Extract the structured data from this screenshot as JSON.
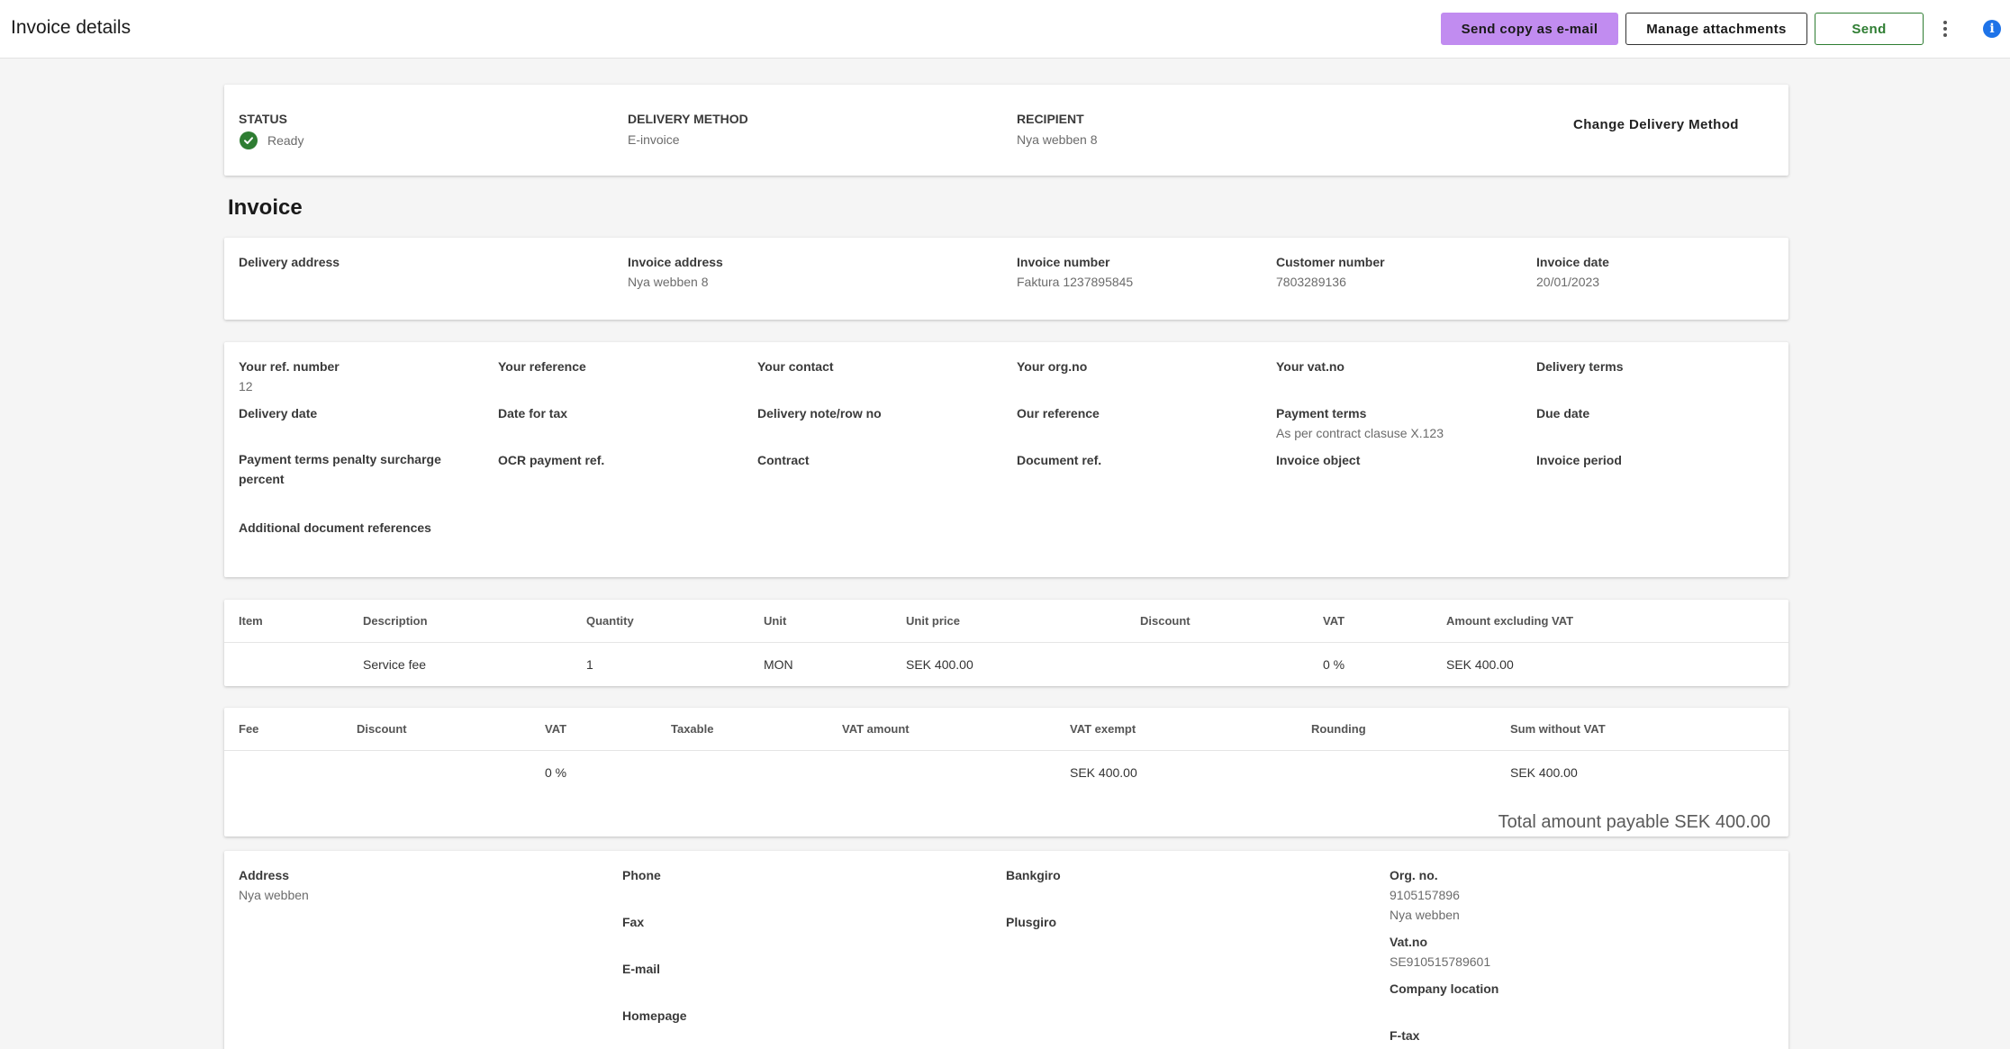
{
  "header": {
    "title": "Invoice details",
    "send_email_label": "Send copy as e-mail",
    "manage_attachments_label": "Manage attachments",
    "send_label": "Send",
    "more_icon": "kebab-menu-icon",
    "info_icon": "info-icon"
  },
  "status_card": {
    "status_label": "STATUS",
    "status_value": "Ready",
    "delivery_method_label": "DELIVERY METHOD",
    "delivery_method_value": "E-invoice",
    "recipient_label": "RECIPIENT",
    "recipient_value": "Nya webben 8",
    "change_label": "Change Delivery Method",
    "status_color": "#2e7d32"
  },
  "invoice": {
    "section_title": "Invoice",
    "delivery_address_label": "Delivery address",
    "invoice_address_label": "Invoice address",
    "invoice_address_value": "Nya webben 8",
    "invoice_number_label": "Invoice number",
    "invoice_number_value": "Faktura 1237895845",
    "customer_number_label": "Customer number",
    "customer_number_value": "7803289136",
    "invoice_date_label": "Invoice date",
    "invoice_date_value": "20/01/2023"
  },
  "details": {
    "your_ref_number_label": "Your ref. number",
    "your_ref_number_value": "12",
    "your_reference_label": "Your reference",
    "your_contact_label": "Your contact",
    "your_org_no_label": "Your org.no",
    "your_vat_no_label": "Your vat.no",
    "delivery_terms_label": "Delivery terms",
    "delivery_date_label": "Delivery date",
    "date_for_tax_label": "Date for tax",
    "delivery_note_label": "Delivery note/row no",
    "our_reference_label": "Our reference",
    "payment_terms_label": "Payment terms",
    "payment_terms_value": "As per contract clasuse X.123",
    "due_date_label": "Due date",
    "penalty_label": "Payment terms penalty surcharge percent",
    "ocr_label": "OCR payment ref.",
    "contract_label": "Contract",
    "document_ref_label": "Document ref.",
    "invoice_object_label": "Invoice object",
    "invoice_period_label": "Invoice period",
    "additional_refs_label": "Additional document references"
  },
  "items_table": {
    "headers": [
      "Item",
      "Description",
      "Quantity",
      "Unit",
      "Unit price",
      "Discount",
      "VAT",
      "Amount excluding VAT"
    ],
    "rows": [
      [
        "",
        "Service fee",
        "1",
        "MON",
        "SEK 400.00",
        "",
        "0 %",
        "SEK 400.00"
      ]
    ]
  },
  "fees_table": {
    "headers": [
      "Fee",
      "Discount",
      "VAT",
      "Taxable",
      "VAT amount",
      "VAT exempt",
      "Rounding",
      "Sum without VAT"
    ],
    "rows": [
      [
        "",
        "",
        "0 %",
        "",
        "",
        "SEK 400.00",
        "",
        "SEK 400.00"
      ]
    ],
    "total": "Total amount payable SEK 400.00"
  },
  "seller": {
    "address_label": "Address",
    "address_value": "Nya webben",
    "phone_label": "Phone",
    "fax_label": "Fax",
    "email_label": "E-mail",
    "homepage_label": "Homepage",
    "bankgiro_label": "Bankgiro",
    "plusgiro_label": "Plusgiro",
    "org_no_label": "Org. no.",
    "org_no_value": "9105157896",
    "org_name_value": "Nya webben",
    "vat_no_label": "Vat.no",
    "vat_no_value": "SE910515789601",
    "company_location_label": "Company location",
    "ftax_label": "F-tax"
  }
}
